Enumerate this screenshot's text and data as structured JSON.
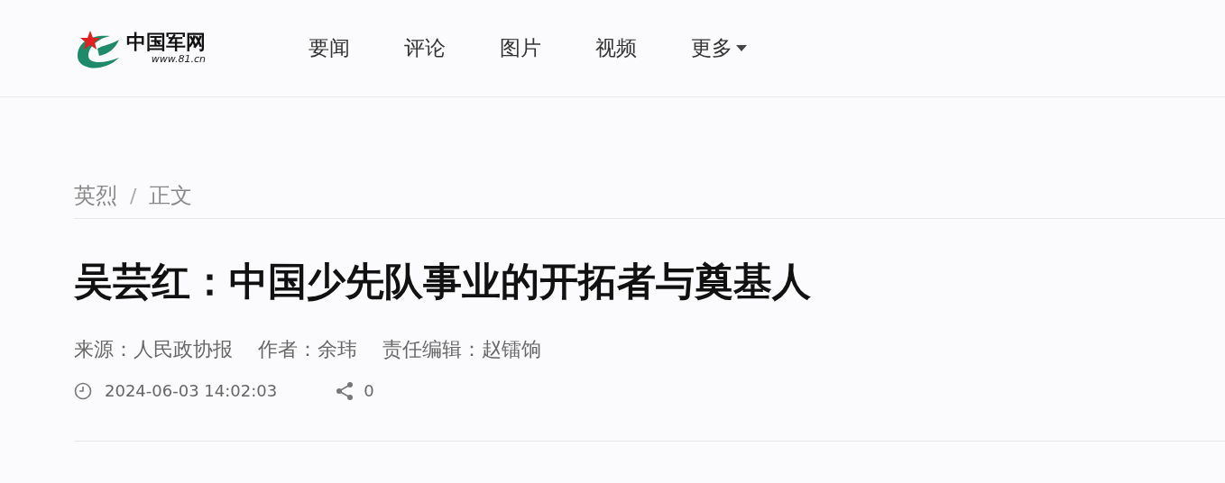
{
  "header": {
    "logo": {
      "title": "中国军网",
      "url": "www.81.cn"
    },
    "nav": [
      {
        "label": "要闻",
        "has_menu": false
      },
      {
        "label": "评论",
        "has_menu": false
      },
      {
        "label": "图片",
        "has_menu": false
      },
      {
        "label": "视频",
        "has_menu": false
      },
      {
        "label": "更多",
        "has_menu": true
      }
    ]
  },
  "breadcrumb": {
    "items": [
      "英烈",
      "正文"
    ],
    "separator": "/"
  },
  "article": {
    "title": "吴芸红：中国少先队事业的开拓者与奠基人",
    "meta": [
      "来源：人民政协报",
      "作者：余玮",
      "责任编辑：赵镭饷"
    ],
    "datetime": "2024-06-03 14:02:03",
    "share_count": "0"
  }
}
